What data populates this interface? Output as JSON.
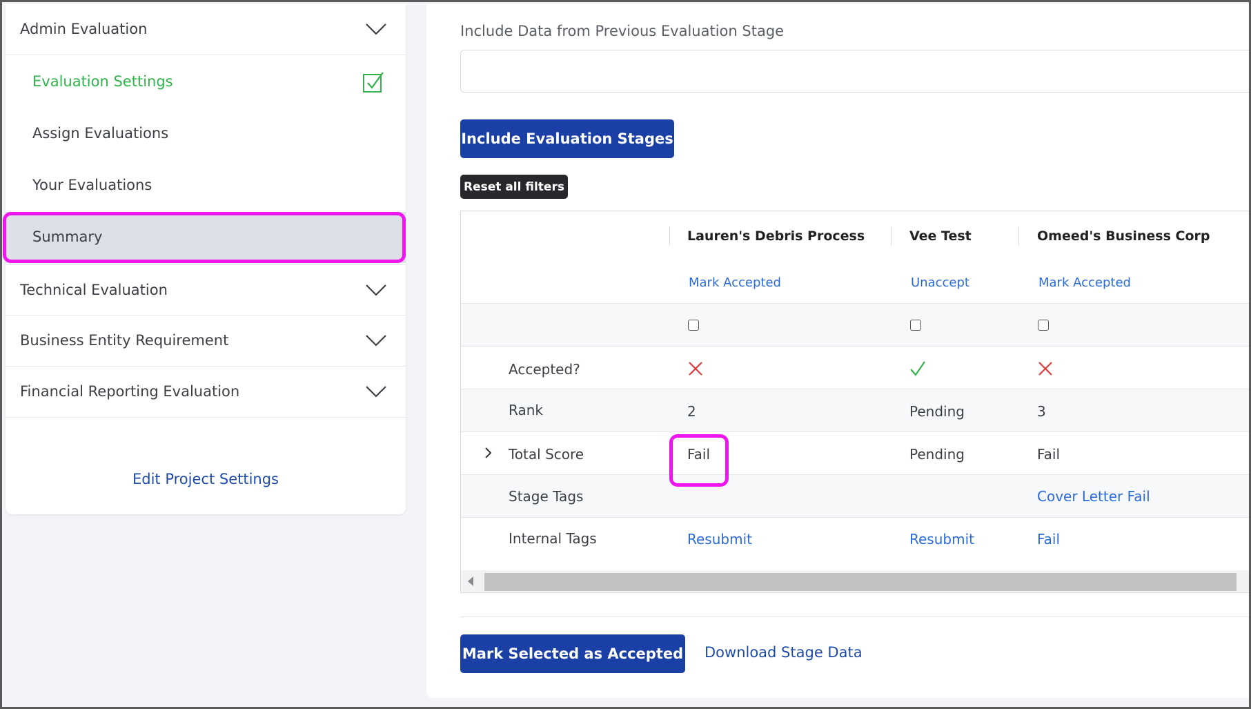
{
  "sidebar": {
    "admin_evaluation": "Admin Evaluation",
    "sub_items": [
      {
        "label": "Evaluation Settings",
        "state": "completed"
      },
      {
        "label": "Assign Evaluations"
      },
      {
        "label": "Your Evaluations"
      },
      {
        "label": "Summary",
        "state": "selected"
      }
    ],
    "sections": [
      {
        "label": "Technical Evaluation"
      },
      {
        "label": "Business Entity Requirement"
      },
      {
        "label": "Financial Reporting Evaluation"
      }
    ],
    "edit_project_settings": "Edit Project Settings"
  },
  "main": {
    "previous_stage_label": "Include Data from Previous Evaluation Stage",
    "previous_stage_value": "",
    "include_stages_button": "Include Evaluation Stages",
    "reset_filters_button": "Reset all filters",
    "table": {
      "columns": [
        "Lauren's Debris Process",
        "Vee Test",
        "Omeed's Business Corp"
      ],
      "accept_actions": [
        "Mark Accepted",
        "Unaccept",
        "Mark Accepted"
      ],
      "rows": {
        "accepted_label": "Accepted?",
        "accepted_values": [
          "no",
          "yes",
          "no"
        ],
        "rank_label": "Rank",
        "rank_values": [
          "2",
          "Pending",
          "3"
        ],
        "total_score_label": "Total Score",
        "total_score_values": [
          "Fail",
          "Pending",
          "Fail"
        ],
        "stage_tags_label": "Stage Tags",
        "stage_tags_values": [
          "",
          "",
          "Cover Letter Fail"
        ],
        "internal_tags_label": "Internal Tags",
        "internal_tags_values": [
          "Resubmit",
          "Resubmit",
          "Fail"
        ]
      }
    },
    "mark_selected_button": "Mark Selected as Accepted",
    "download_link": "Download Stage Data"
  },
  "colors": {
    "primary": "#1a3fa5",
    "link": "#2b6ad8",
    "success": "#2fb34a",
    "danger": "#e03a3a",
    "highlight": "#ef15ee"
  }
}
